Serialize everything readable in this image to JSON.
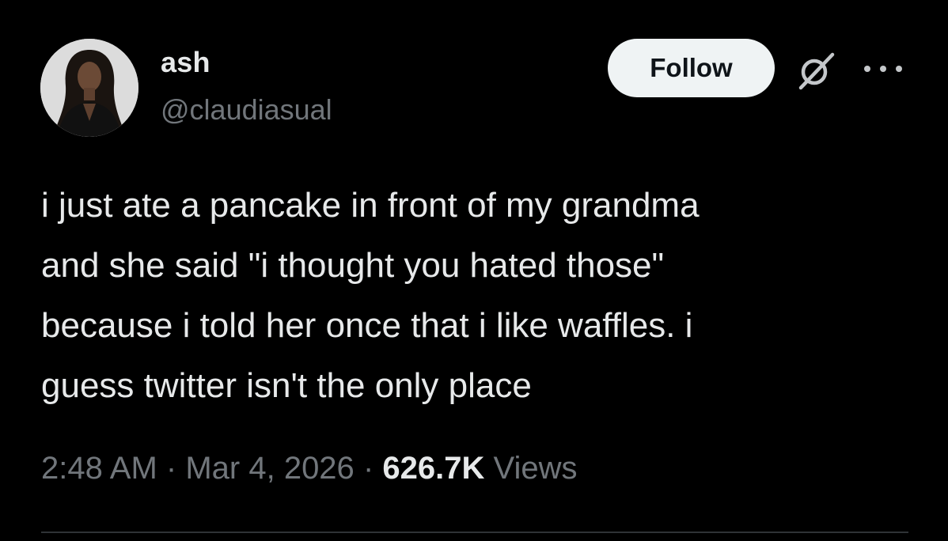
{
  "author": {
    "name": "ash",
    "handle": "@claudiasual"
  },
  "actions": {
    "follow_label": "Follow",
    "grok_icon": "grok-icon",
    "more_icon": "more-icon"
  },
  "tweet": {
    "lines": [
      "i just ate a pancake in front of my grandma",
      "and she said \"i thought you hated those\"",
      "because i told her once that i like waffles. i",
      "guess twitter isn't the only place"
    ]
  },
  "meta": {
    "time": "2:48 AM",
    "separator": "·",
    "date": "Mar 4, 2026",
    "views_count": "626.7K",
    "views_label": "Views"
  },
  "colors": {
    "background": "#000000",
    "text_primary": "#e7e9ea",
    "text_secondary": "#71767b",
    "follow_bg": "#eff3f4"
  }
}
